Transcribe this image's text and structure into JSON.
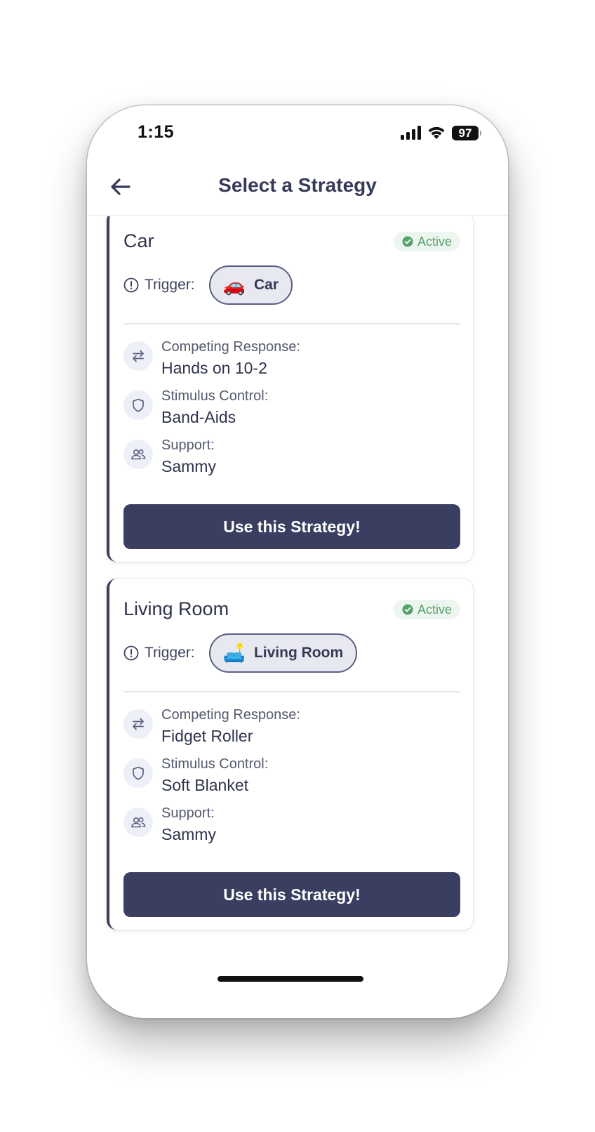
{
  "status_bar": {
    "time": "1:15",
    "battery": "97"
  },
  "header": {
    "title": "Select a Strategy"
  },
  "strategies": [
    {
      "title": "Car",
      "badge": "Active",
      "trigger_label": "Trigger:",
      "trigger_emoji": "🚗",
      "trigger_value": "Car",
      "competing_label": "Competing Response:",
      "competing_value": "Hands on 10-2",
      "stimulus_label": "Stimulus Control:",
      "stimulus_value": "Band-Aids",
      "support_label": "Support:",
      "support_value": "Sammy",
      "button_label": "Use this Strategy!"
    },
    {
      "title": "Living Room",
      "badge": "Active",
      "trigger_label": "Trigger:",
      "trigger_emoji": "🛋️",
      "trigger_value": "Living Room",
      "competing_label": "Competing Response:",
      "competing_value": "Fidget Roller",
      "stimulus_label": "Stimulus Control:",
      "stimulus_value": "Soft Blanket",
      "support_label": "Support:",
      "support_value": "Sammy",
      "button_label": "Use this Strategy!"
    }
  ],
  "icons": {
    "back": "arrow-left-icon",
    "check": "check-circle-icon",
    "trigger": "alert-circle-icon",
    "competing": "swap-arrows-icon",
    "stimulus": "shield-icon",
    "support": "users-icon"
  },
  "colors": {
    "primary": "#3a3f62",
    "active_text": "#57a06a",
    "active_bg": "#ecf6ee",
    "chip_bg": "#e7e8f0"
  }
}
